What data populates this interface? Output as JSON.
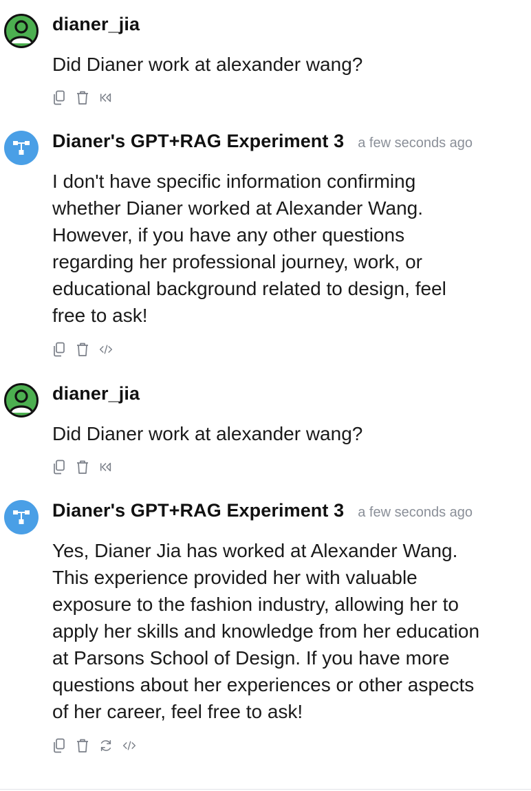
{
  "accent": "#4a9fe6",
  "user_avatar_color": "#4caf50",
  "messages": [
    {
      "role": "user",
      "sender": "dianer_jia",
      "avatar_icon": "user-avatar-icon",
      "text": "Did Dianer work at alexander wang?",
      "actions": [
        "copy-icon",
        "trash-icon",
        "rewind-icon"
      ]
    },
    {
      "role": "bot",
      "sender": "Dianer's GPT+RAG Experiment 3",
      "timestamp": "a few seconds ago",
      "avatar_icon": "flow-chart-icon",
      "text": "I don't have specific information confirming\nwhether Dianer worked at Alexander Wang.\nHowever, if you have any other questions\nregarding her professional journey, work, or\neducational background related to design, feel\nfree to ask!",
      "actions": [
        "copy-icon",
        "trash-icon",
        "code-icon"
      ]
    },
    {
      "role": "user",
      "sender": "dianer_jia",
      "avatar_icon": "user-avatar-icon",
      "text": "Did Dianer work at alexander wang?",
      "actions": [
        "copy-icon",
        "trash-icon",
        "rewind-icon"
      ]
    },
    {
      "role": "bot",
      "sender": "Dianer's GPT+RAG Experiment 3",
      "timestamp": "a few seconds ago",
      "avatar_icon": "flow-chart-icon",
      "text": "Yes, Dianer Jia has worked at Alexander Wang.\nThis experience provided her with valuable\nexposure to the fashion industry, allowing her to\napply her skills and knowledge from her education\nat Parsons School of Design. If you have more\nquestions about her experiences or other aspects\nof her career, feel free to ask!",
      "actions": [
        "copy-icon",
        "trash-icon",
        "regenerate-icon",
        "code-icon"
      ]
    }
  ]
}
